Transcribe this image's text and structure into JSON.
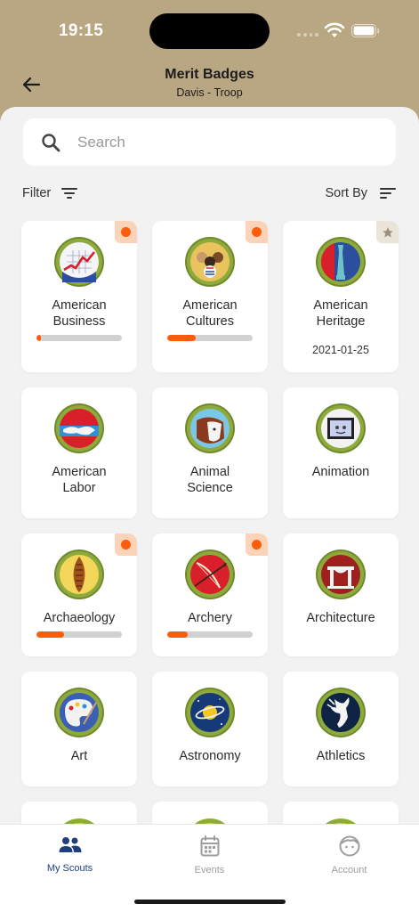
{
  "status": {
    "time": "19:15"
  },
  "header": {
    "title": "Merit Badges",
    "subtitle": "Davis - Troop"
  },
  "search": {
    "placeholder": "Search",
    "value": ""
  },
  "toolbar": {
    "filter_label": "Filter",
    "sort_label": "Sort By"
  },
  "badges": [
    {
      "name": "American\nBusiness",
      "progress": 0.05,
      "indicator": "in-progress",
      "icon": "american-business-badge"
    },
    {
      "name": "American\nCultures",
      "progress": 0.33,
      "indicator": "in-progress",
      "icon": "american-cultures-badge"
    },
    {
      "name": "American\nHeritage",
      "date": "2021-01-25",
      "indicator": "completed-star",
      "icon": "american-heritage-badge"
    },
    {
      "name": "American\nLabor",
      "icon": "american-labor-badge"
    },
    {
      "name": "Animal\nScience",
      "icon": "animal-science-badge"
    },
    {
      "name": "Animation",
      "icon": "animation-badge"
    },
    {
      "name": "Archaeology",
      "progress": 0.32,
      "indicator": "in-progress",
      "icon": "archaeology-badge"
    },
    {
      "name": "Archery",
      "progress": 0.24,
      "indicator": "in-progress",
      "icon": "archery-badge"
    },
    {
      "name": "Architecture",
      "icon": "architecture-badge"
    },
    {
      "name": "Art",
      "icon": "art-badge"
    },
    {
      "name": "Astronomy",
      "icon": "astronomy-badge"
    },
    {
      "name": "Athletics",
      "icon": "athletics-badge"
    }
  ],
  "tabs": [
    {
      "label": "My Scouts",
      "active": true,
      "icon": "people-icon"
    },
    {
      "label": "Events",
      "active": false,
      "icon": "calendar-icon"
    },
    {
      "label": "Account",
      "active": false,
      "icon": "account-face-icon"
    }
  ],
  "colors": {
    "header_bg": "#b9a682",
    "accent": "#fc5d0b",
    "active_tab": "#1f3f7a",
    "inactive_tab": "#9e9e9e",
    "badge_border": "#8faa3c"
  }
}
